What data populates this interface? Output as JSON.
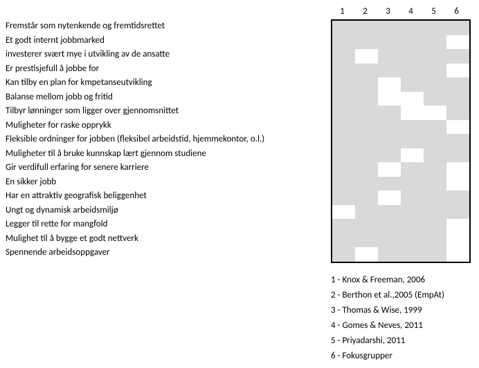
{
  "chart_data": {
    "type": "heatmap",
    "title": "",
    "columns": [
      "1",
      "2",
      "3",
      "4",
      "5",
      "6"
    ],
    "rows": [
      "Fremstår som nytenkende og fremtidsrettet",
      "Et godt internt jobbmarked",
      "investerer svært mye i utvikling av de ansatte",
      "Er prestisjefull å jobbe for",
      "Kan tilby en plan for kmpetanseutvikling",
      "Balanse mellom jobb og fritid",
      "Tilbyr lønninger som ligger over gjennomsnittet",
      "Muligheter for raske opprykk",
      "Fleksible ordninger for jobben (fleksibel arbeidstid, hjemmekontor, o.l.)",
      "Muligheter til å bruke kunnskap lært gjennom studiene",
      "Gir verdifull erfaring for senere karriere",
      "En sikker jobb",
      "Har en attraktiv geografisk beliggenhet",
      "Ungt og dynamisk arbeidsmiljø",
      "Legger til rette for mangfold",
      "Mulighet til å bygge et godt nettverk",
      "Spennende arbeidsoppgaver"
    ],
    "matrix": [
      [
        1,
        1,
        1,
        1,
        1,
        1
      ],
      [
        1,
        1,
        1,
        1,
        1,
        0
      ],
      [
        1,
        0,
        1,
        1,
        1,
        1
      ],
      [
        1,
        1,
        1,
        1,
        1,
        0
      ],
      [
        1,
        1,
        0,
        1,
        1,
        1
      ],
      [
        1,
        1,
        0,
        0,
        1,
        1
      ],
      [
        1,
        1,
        1,
        0,
        0,
        1
      ],
      [
        1,
        1,
        1,
        1,
        1,
        0
      ],
      [
        1,
        1,
        1,
        1,
        1,
        1
      ],
      [
        1,
        1,
        1,
        0,
        1,
        1
      ],
      [
        1,
        1,
        0,
        1,
        1,
        0
      ],
      [
        1,
        1,
        1,
        1,
        1,
        0
      ],
      [
        1,
        1,
        0,
        1,
        1,
        1
      ],
      [
        0,
        1,
        1,
        1,
        1,
        1
      ],
      [
        1,
        1,
        1,
        1,
        1,
        0
      ],
      [
        1,
        1,
        1,
        1,
        1,
        0
      ],
      [
        1,
        0,
        1,
        1,
        1,
        0
      ]
    ],
    "legend": [
      "1 - Knox & Freeman, 2006",
      "2 - Berthon et al.,2005 (EmpAt)",
      "3 - Thomas & Wise, 1999",
      "4 - Gomes & Neves, 2011",
      "5 - Priyadarshi, 2011",
      "6 - Fokusgrupper"
    ]
  }
}
